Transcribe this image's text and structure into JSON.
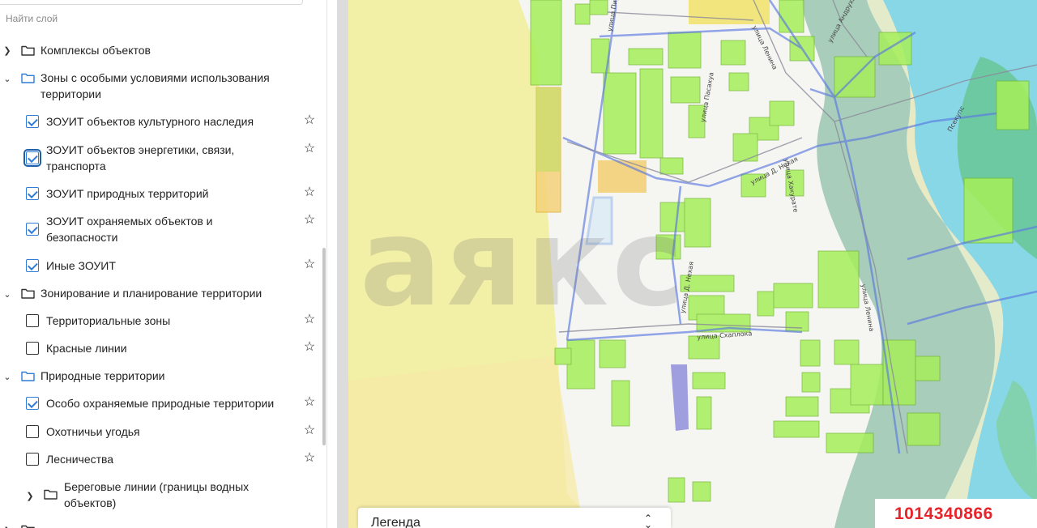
{
  "search": {
    "placeholder": "Найти слой"
  },
  "layers": [
    {
      "type": "group",
      "label": "Комплексы объектов",
      "expanded": false
    },
    {
      "type": "group",
      "label_line1": "Зоны с особыми условиями использования",
      "label_line2": "территории",
      "expanded": true,
      "open_folder": true
    },
    {
      "type": "layer",
      "label": "ЗОУИТ объектов культурного наследия",
      "checked": true
    },
    {
      "type": "layer",
      "label_line1": "ЗОУИТ объектов энергетики, связи,",
      "label_line2": "транспорта",
      "checked": true,
      "focused": true
    },
    {
      "type": "layer",
      "label": "ЗОУИТ природных территорий",
      "checked": true
    },
    {
      "type": "layer",
      "label_line1": "ЗОУИТ охраняемых объектов и",
      "label_line2": "безопасности",
      "checked": true
    },
    {
      "type": "layer",
      "label": "Иные ЗОУИТ",
      "checked": true
    },
    {
      "type": "group",
      "label": "Зонирование и планирование территории",
      "expanded": true
    },
    {
      "type": "layer",
      "label": "Территориальные зоны",
      "checked": false
    },
    {
      "type": "layer",
      "label": "Красные линии",
      "checked": false
    },
    {
      "type": "group",
      "label": "Природные территории",
      "expanded": true,
      "open_folder": true
    },
    {
      "type": "layer",
      "label": "Особо охраняемые природные территории",
      "checked": true
    },
    {
      "type": "layer",
      "label": "Охотничьи угодья",
      "checked": false
    },
    {
      "type": "layer",
      "label": "Лесничества",
      "checked": false
    },
    {
      "type": "subgroup",
      "label_line1": "Береговые линии (границы водных",
      "label_line2": "объектов)",
      "expanded": false
    }
  ],
  "map": {
    "watermark": "аякс",
    "streets": [
      "улица Пирануа",
      "улица Пасахуа",
      "улица Д. Нехая",
      "улица Хакурате",
      "улица Схаплока",
      "улица Д. Нехая",
      "улица Ленина",
      "улица Андрухаева",
      "улица Ленина",
      "Псекупс"
    ]
  },
  "legend": {
    "title": "Легенда",
    "toggle_icon": "chevron-updown-icon"
  },
  "listing": {
    "id": "1014340866"
  },
  "colors": {
    "accent": "#2f7cd6",
    "zone_green": "#a6ef5a",
    "water_blue": "#7fd6ef",
    "listing_red": "#e8232a"
  }
}
